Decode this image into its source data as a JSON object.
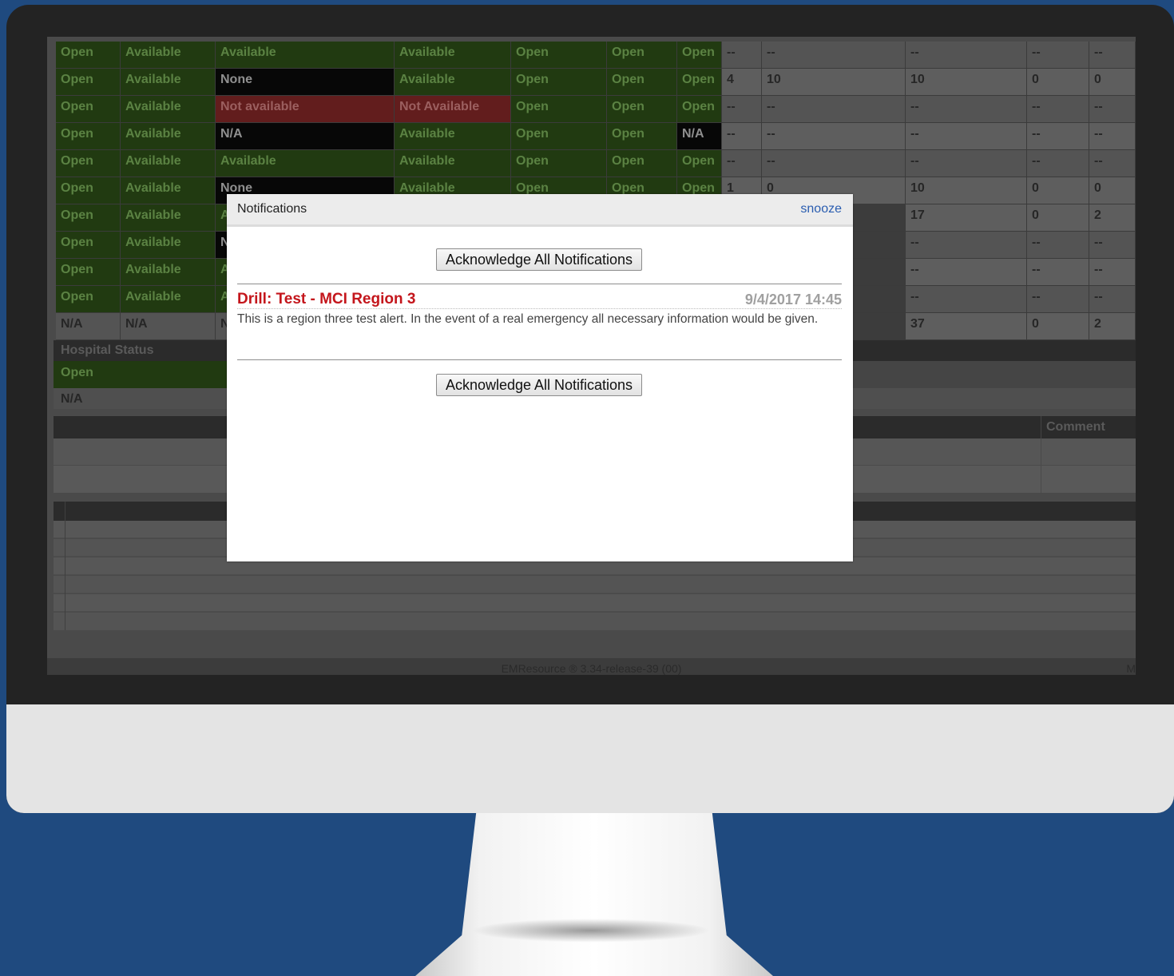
{
  "grid": {
    "columns": [
      "c1",
      "c2",
      "c3",
      "c4",
      "c5",
      "c6",
      "c7",
      "c8",
      "c9",
      "c10",
      "c11",
      "c12"
    ],
    "rows": [
      [
        "Open",
        "Available",
        "Available",
        "Available",
        "Open",
        "Open",
        "Open",
        "--",
        "--",
        "--",
        "--",
        "--"
      ],
      [
        "Open",
        "Available",
        "None",
        "Available",
        "Open",
        "Open",
        "Open",
        "4",
        "10",
        "10",
        "0",
        "0"
      ],
      [
        "Open",
        "Available",
        "Not available",
        "Not Available",
        "Open",
        "Open",
        "Open",
        "--",
        "--",
        "--",
        "--",
        "--"
      ],
      [
        "Open",
        "Available",
        "N/A",
        "Available",
        "Open",
        "Open",
        "N/A",
        "--",
        "--",
        "--",
        "--",
        "--"
      ],
      [
        "Open",
        "Available",
        "Available",
        "Available",
        "Open",
        "Open",
        "Open",
        "--",
        "--",
        "--",
        "--",
        "--"
      ],
      [
        "Open",
        "Available",
        "None",
        "Available",
        "Open",
        "Open",
        "Open",
        "1",
        "0",
        "10",
        "0",
        "0"
      ],
      [
        "Open",
        "Available",
        "A",
        "",
        "",
        "",
        "",
        "",
        "",
        "17",
        "0",
        "2"
      ],
      [
        "Open",
        "Available",
        "N",
        "",
        "",
        "",
        "",
        "",
        "",
        "--",
        "--",
        "--"
      ],
      [
        "Open",
        "Available",
        "A",
        "",
        "",
        "",
        "",
        "",
        "",
        "--",
        "--",
        "--"
      ],
      [
        "Open",
        "Available",
        "A",
        "",
        "",
        "",
        "",
        "",
        "",
        "--",
        "--",
        "--"
      ],
      [
        "N/A",
        "N/A",
        "N",
        "",
        "",
        "",
        "",
        "",
        "",
        "37",
        "0",
        "2"
      ]
    ]
  },
  "section": {
    "hospital_status_label": "Hospital Status",
    "status_value": "Open",
    "status_na": "N/A",
    "comment_header": "Comment"
  },
  "footer": {
    "text": "EMResource ® 3.34-release-39 (00)",
    "right": "M"
  },
  "modal": {
    "title": "Notifications",
    "snooze_label": "snooze",
    "ack_label": "Acknowledge All Notifications",
    "notification": {
      "title": "Drill: Test - MCI Region 3",
      "time": "9/4/2017 14:45",
      "body": "This is a region three test alert. In the event of a real emergency all necessary information would be given."
    }
  },
  "colors": {
    "background": "#1f4a7f",
    "status_green": "#213a11",
    "status_red": "#621d1d",
    "alert_title": "#c4161c",
    "link": "#2a5db0"
  }
}
